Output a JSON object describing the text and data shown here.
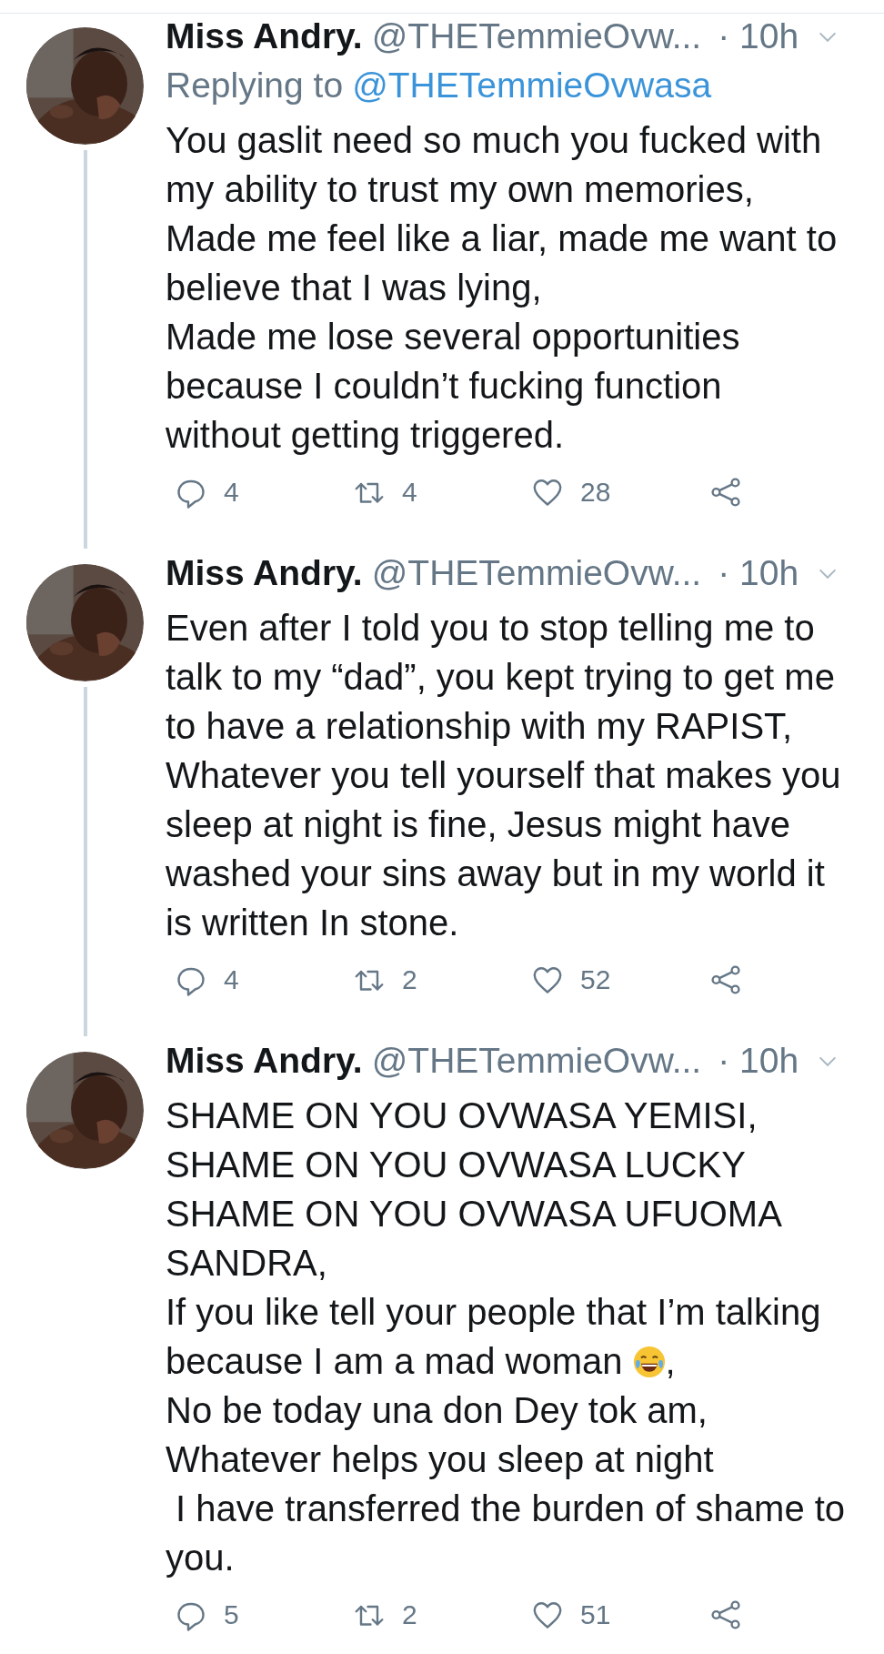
{
  "tweets": [
    {
      "name": "Miss Andry.",
      "handle": "@THETemmieOvw...",
      "time": "· 10h",
      "has_thread_line": true,
      "replying": {
        "label": "Replying to",
        "mention": "@THETemmieOvwasa"
      },
      "lines": [
        "You gaslit need so much you fucked with",
        "my ability to trust my own memories,",
        "Made me feel like a liar, made me want to",
        "believe that I was lying,",
        "Made me lose several opportunities",
        "because I couldn’t fucking function",
        "without getting triggered."
      ],
      "actions": {
        "replies": "4",
        "retweets": "4",
        "likes": "28"
      }
    },
    {
      "name": "Miss Andry.",
      "handle": "@THETemmieOvw...",
      "time": "· 10h",
      "has_thread_line": true,
      "lines": [
        "Even after I told you to stop telling me to",
        "talk to my “dad”, you kept trying to get me",
        "to have a relationship with my RAPIST,",
        "Whatever you tell yourself that makes you",
        "sleep at night is fine, Jesus might have",
        "washed your sins away but in my world it",
        "is written In stone."
      ],
      "actions": {
        "replies": "4",
        "retweets": "2",
        "likes": "52"
      }
    },
    {
      "name": "Miss Andry.",
      "handle": "@THETemmieOvw...",
      "time": "· 10h",
      "has_thread_line": false,
      "lines": [
        "SHAME ON YOU OVWASA YEMISI,",
        "SHAME ON YOU OVWASA LUCKY",
        "SHAME ON YOU OVWASA UFUOMA",
        "SANDRA,",
        "If you like tell your people that I’m talking",
        [
          "because I am a mad woman ",
          {
            "kind": "emoji"
          },
          ","
        ],
        "No be today una don Dey tok am,",
        "Whatever helps you sleep at night",
        " I have transferred the burden of shame to",
        "you."
      ],
      "actions": {
        "replies": "5",
        "retweets": "2",
        "likes": "51"
      }
    }
  ]
}
